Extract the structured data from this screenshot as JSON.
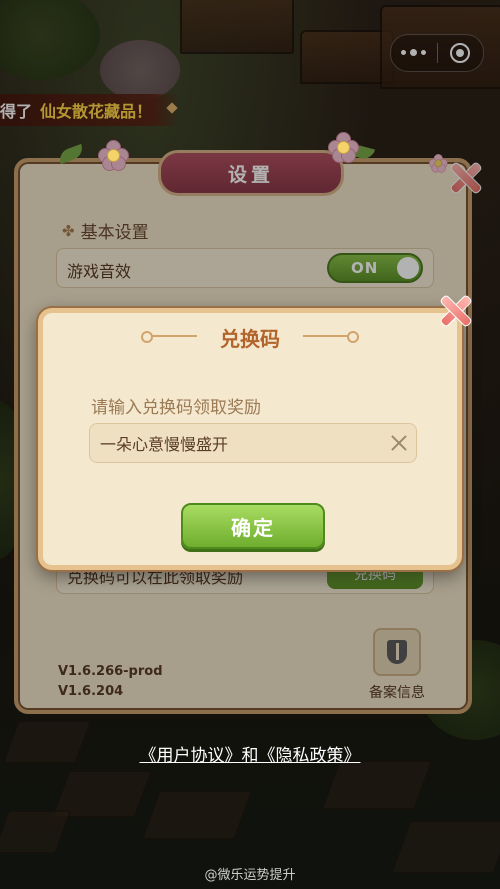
{
  "notification": {
    "prefix": "得了",
    "item": "仙女散花藏品！"
  },
  "settings": {
    "title": "设置",
    "section_basic": "基本设置",
    "sound_label": "游戏音效",
    "sound_toggle": "ON",
    "redeem_row_label": "兑换码可以在此领取奖励",
    "redeem_row_button": "兑换码",
    "version_1": "V1.6.266-prod",
    "version_2": "V1.6.204",
    "record_label": "备案信息"
  },
  "dialog": {
    "title": "兑换码",
    "prompt": "请输入兑换码领取奖励",
    "code_value": "一朵心意慢慢盛开",
    "confirm_label": "确定"
  },
  "footer": {
    "user_agreement": "《用户协议》",
    "and": "和",
    "privacy_policy": "《隐私政策》"
  },
  "watermark": "@微乐运势提升"
}
